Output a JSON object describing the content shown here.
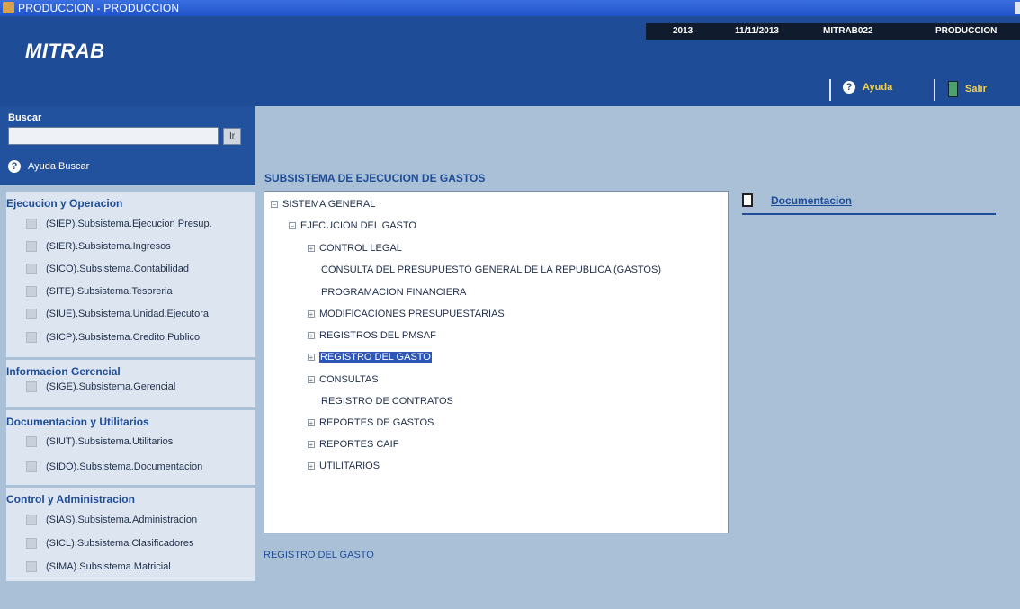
{
  "window": {
    "title": "PRODUCCION - PRODUCCION"
  },
  "header": {
    "logo": "MITRAB",
    "info": {
      "year": "2013",
      "date": "11/11/2013",
      "user": "MITRAB022",
      "env": "PRODUCCION"
    },
    "help_label": "Ayuda",
    "exit_label": "Salir"
  },
  "search": {
    "label": "Buscar",
    "value": "",
    "go_label": "Ir",
    "help_label": "Ayuda Buscar"
  },
  "sections": [
    {
      "title": "Ejecucion y Operacion",
      "items": [
        "(SIEP).Subsistema.Ejecucion Presup.",
        "(SIER).Subsistema.Ingresos",
        "(SICO).Subsistema.Contabilidad",
        "(SITE).Subsistema.Tesoreria",
        "(SIUE).Subsistema.Unidad.Ejecutora",
        "(SICP).Subsistema.Credito.Publico"
      ]
    },
    {
      "title": "Informacion Gerencial",
      "items": [
        "(SIGE).Subsistema.Gerencial"
      ]
    },
    {
      "title": "Documentacion y Utilitarios",
      "items": [
        "(SIUT).Subsistema.Utilitarios",
        "(SIDO).Subsistema.Documentacion"
      ]
    },
    {
      "title": "Control y Administracion",
      "items": [
        "(SIAS).Subsistema.Administracion",
        "(SICL).Subsistema.Clasificadores",
        "(SIMA).Subsistema.Matricial"
      ]
    }
  ],
  "main": {
    "title": "SUBSISTEMA DE EJECUCION DE GASTOS",
    "tree": [
      {
        "label": "SISTEMA GENERAL",
        "toggle": "−"
      },
      {
        "label": "EJECUCION DEL GASTO",
        "toggle": "−"
      },
      {
        "label": "CONTROL LEGAL",
        "toggle": "+"
      },
      {
        "label": "CONSULTA DEL PRESUPUESTO GENERAL DE LA REPUBLICA (GASTOS)",
        "toggle": ""
      },
      {
        "label": "PROGRAMACION FINANCIERA",
        "toggle": ""
      },
      {
        "label": "MODIFICACIONES PRESUPUESTARIAS",
        "toggle": "+"
      },
      {
        "label": "REGISTROS DEL PMSAF",
        "toggle": "+"
      },
      {
        "label": "REGISTRO DEL GASTO",
        "toggle": "+",
        "selected": true
      },
      {
        "label": "CONSULTAS",
        "toggle": "+"
      },
      {
        "label": "REGISTRO DE CONTRATOS",
        "toggle": ""
      },
      {
        "label": "REPORTES  DE GASTOS",
        "toggle": "+"
      },
      {
        "label": "REPORTES CAIF",
        "toggle": "+"
      },
      {
        "label": "UTILITARIOS",
        "toggle": "+"
      }
    ],
    "status": "REGISTRO DEL GASTO",
    "doc_link": "Documentacion"
  }
}
